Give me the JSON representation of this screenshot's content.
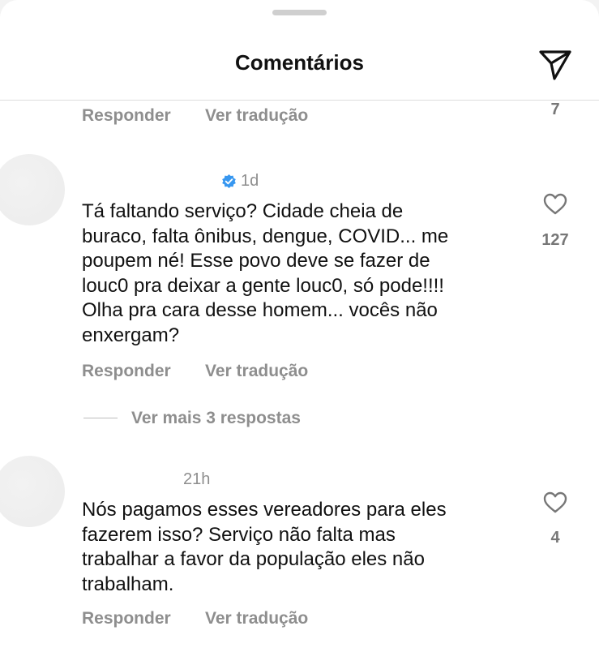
{
  "header": {
    "title": "Comentários"
  },
  "top_row": {
    "reply_label": "Responder",
    "translate_label": "Ver tradução",
    "like_count": "7"
  },
  "comments": [
    {
      "username": "",
      "time": "1d",
      "verified": true,
      "text": "Tá faltando serviço? Cidade cheia de\nburaco, falta ônibus, dengue, COVID... me\npoupem né! Esse povo deve se fazer de\nlouc0 pra deixar a gente louc0, só pode!!!!\nOlha pra cara desse homem... vocês não\nenxergam?",
      "like_count": "127",
      "reply_label": "Responder",
      "translate_label": "Ver tradução",
      "view_replies_label": "Ver mais 3 respostas"
    },
    {
      "username": "",
      "time": "21h",
      "verified": false,
      "text": "Nós pagamos esses vereadores para eles\nfazerem isso? Serviço não falta mas\ntrabalhar a favor da população eles não\ntrabalham.",
      "like_count": "4",
      "reply_label": "Responder",
      "translate_label": "Ver tradução"
    }
  ],
  "colors": {
    "text_primary": "#111111",
    "text_secondary": "#8e8e8e",
    "verified_badge": "#3797f0"
  },
  "icons": [
    "send-icon",
    "heart-icon",
    "verified-badge-icon"
  ]
}
